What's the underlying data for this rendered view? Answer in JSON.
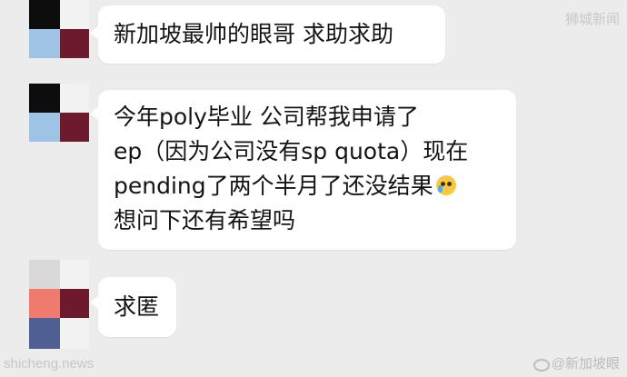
{
  "watermarks": {
    "top_right": "狮城新闻",
    "bottom_left": "shicheng.news",
    "bottom_right": "@新加坡眼"
  },
  "messages": [
    {
      "lines": [
        "新加坡最帅的眼哥 求助求助"
      ]
    },
    {
      "lines": [
        "今年poly毕业 公司帮我申请了",
        "ep（因为公司没有sp quota）现在",
        "pending了两个半月了还没结果",
        "想问下还有希望吗"
      ],
      "emoji": "crying-face"
    },
    {
      "lines": [
        "求匿"
      ]
    }
  ],
  "colors": {
    "chat_background": "#ececec",
    "bubble": "#ffffff",
    "text": "#141414",
    "avatar_palette": [
      "#0d0d0d",
      "#f2f2f2",
      "#9ec3e5",
      "#6e1a2e",
      "#d9d9d9",
      "#f07a6e",
      "#4f5e93"
    ]
  }
}
